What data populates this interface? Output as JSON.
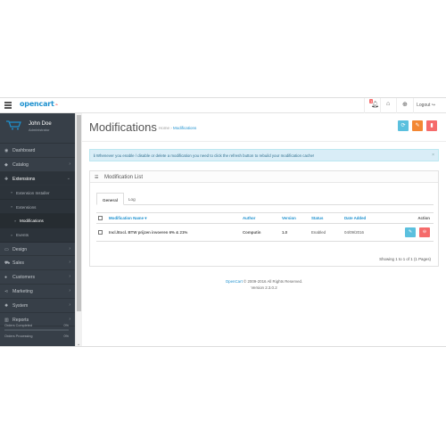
{
  "header": {
    "logo_text": "opencart",
    "logo_mark": "Issue",
    "notif_count": "1",
    "logout_label": "Logout"
  },
  "profile": {
    "name": "John Doe",
    "role": "Administrator"
  },
  "sidebar": {
    "items": [
      {
        "label": "Dashboard",
        "icon": "dashboard-icon"
      },
      {
        "label": "Catalog",
        "icon": "tag-icon"
      },
      {
        "label": "Extensions",
        "icon": "puzzle-icon"
      },
      {
        "label": "Design",
        "icon": "monitor-icon"
      },
      {
        "label": "Sales",
        "icon": "cart-icon"
      },
      {
        "label": "Customers",
        "icon": "user-icon"
      },
      {
        "label": "Marketing",
        "icon": "share-icon"
      },
      {
        "label": "System",
        "icon": "cog-icon"
      },
      {
        "label": "Reports",
        "icon": "bar-chart-icon"
      }
    ],
    "sub_items": [
      {
        "label": "Extension Installer"
      },
      {
        "label": "Extensions"
      },
      {
        "label": "Modifications"
      },
      {
        "label": "Events"
      }
    ],
    "stats": [
      {
        "label": "Orders Completed",
        "pct": "0%",
        "value": 0
      },
      {
        "label": "Orders Processing",
        "pct": "0%",
        "value": 0
      }
    ]
  },
  "page": {
    "title": "Modifications",
    "breadcrumb_home": "Home",
    "breadcrumb_sep": "›",
    "breadcrumb_current": "Modifications"
  },
  "alert": {
    "text": "ℹ Whenever you enable / disable or delete a modification you need to click the refresh button to rebuild your modification cache!",
    "close": "×"
  },
  "panel": {
    "title": "Modification List",
    "tabs": [
      "General",
      "Log"
    ]
  },
  "table": {
    "headers": {
      "name": "Modification Name ▾",
      "author": "Author",
      "version": "Version",
      "status": "Status",
      "date_added": "Date Added",
      "action": "Action"
    },
    "rows": [
      {
        "name": "Incl./Excl. BTW prijzen invoeren 6% & 21%",
        "author": "Computin",
        "version": "1.0",
        "status": "Enabled",
        "date_added": "04/09/2016"
      }
    ],
    "showing": "Showing 1 to 1 of 1 (1 Pages)"
  },
  "footer": {
    "brand": "OpenCart",
    "copyright": " © 2009-2016 All Rights Reserved.",
    "version": "Version 2.3.0.2"
  },
  "colors": {
    "accent": "#1e91cf",
    "sidebar_bg": "#373f48",
    "btn_info": "#5bc0de",
    "btn_warning": "#f38733",
    "btn_danger": "#f56b6b",
    "alert_bg": "#d9edf7"
  }
}
